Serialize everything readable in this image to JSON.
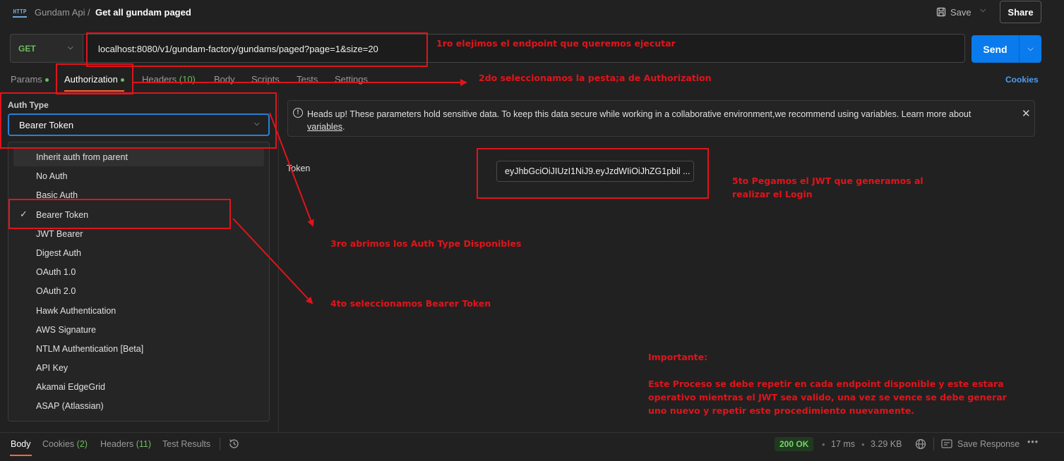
{
  "header": {
    "collection": "Gundam Api",
    "separator": "/",
    "request_title": "Get all gundam paged",
    "save_label": "Save",
    "share_label": "Share"
  },
  "request": {
    "method": "GET",
    "url": "localhost:8080/v1/gundam-factory/gundams/paged?page=1&size=20",
    "send_label": "Send"
  },
  "tabs": {
    "params": "Params",
    "authorization": "Authorization",
    "headers": "Headers",
    "headers_count": "(10)",
    "body": "Body",
    "scripts": "Scripts",
    "tests": "Tests",
    "settings": "Settings",
    "cookies": "Cookies"
  },
  "auth": {
    "label": "Auth Type",
    "selected": "Bearer Token",
    "options": [
      "Inherit auth from parent",
      "No Auth",
      "Basic Auth",
      "Bearer Token",
      "JWT Bearer",
      "Digest Auth",
      "OAuth 1.0",
      "OAuth 2.0",
      "Hawk Authentication",
      "AWS Signature",
      "NTLM Authentication [Beta]",
      "API Key",
      "Akamai EdgeGrid",
      "ASAP (Atlassian)"
    ]
  },
  "notice": {
    "text": "Heads up! These parameters hold sensitive data. To keep this data secure while working in a collaborative environment,we recommend using variables. Learn more about",
    "link": "variables",
    "tail": "."
  },
  "token": {
    "label": "Token",
    "value": "eyJhbGciOiJIUzI1NiJ9.eyJzdWIiOiJhZG1pbil ..."
  },
  "annotations": {
    "step1": "1ro elejimos el endpoint que queremos ejecutar",
    "step2": "2do seleccionamos la pesta;a de Authorization",
    "step3": "3ro abrimos los Auth Type Disponibles",
    "step4": "4to seleccionamos Bearer Token",
    "step5_line1": "5to Pegamos el JWT que generamos al",
    "step5_line2": "realizar el Login",
    "important_title": "Importante:",
    "important_line1": "Este Proceso se debe repetir en cada endpoint disponible y este estara",
    "important_line2": "operativo mientras el JWT sea valido, una vez se vence se debe generar",
    "important_line3": "uno nuevo y repetir este procedimiento nuevamente.",
    "color": "#e0141b"
  },
  "footer": {
    "body": "Body",
    "cookies": "Cookies",
    "cookies_count": "(2)",
    "headers": "Headers",
    "headers_count": "(11)",
    "test_results": "Test Results",
    "status": "200 OK",
    "time": "17 ms",
    "size": "3.29 KB",
    "save_response": "Save Response"
  },
  "colors": {
    "accent": "#f26b3a",
    "send": "#097bed",
    "method_get": "#6bbd5b"
  }
}
